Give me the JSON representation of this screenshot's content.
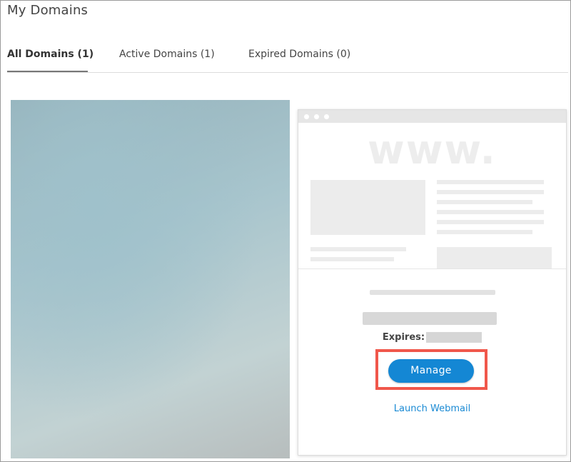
{
  "header": {
    "title": "My Domains"
  },
  "tabs": [
    {
      "label": "All Domains (1)",
      "active": true
    },
    {
      "label": "Active Domains (1)",
      "active": false
    },
    {
      "label": "Expired Domains (0)",
      "active": false
    }
  ],
  "domain_card": {
    "preview_text": "www.",
    "expires_label": "Expires:",
    "manage_label": "Manage",
    "webmail_label": "Launch Webmail",
    "accent_color": "#1487d4",
    "highlight_color": "#f0574b"
  }
}
